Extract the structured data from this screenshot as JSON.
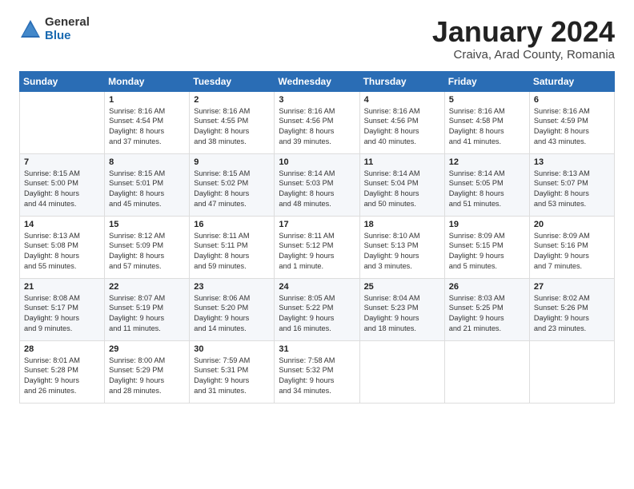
{
  "logo": {
    "general": "General",
    "blue": "Blue"
  },
  "title": "January 2024",
  "subtitle": "Craiva, Arad County, Romania",
  "headers": [
    "Sunday",
    "Monday",
    "Tuesday",
    "Wednesday",
    "Thursday",
    "Friday",
    "Saturday"
  ],
  "weeks": [
    [
      {
        "day": "",
        "info": ""
      },
      {
        "day": "1",
        "info": "Sunrise: 8:16 AM\nSunset: 4:54 PM\nDaylight: 8 hours\nand 37 minutes."
      },
      {
        "day": "2",
        "info": "Sunrise: 8:16 AM\nSunset: 4:55 PM\nDaylight: 8 hours\nand 38 minutes."
      },
      {
        "day": "3",
        "info": "Sunrise: 8:16 AM\nSunset: 4:56 PM\nDaylight: 8 hours\nand 39 minutes."
      },
      {
        "day": "4",
        "info": "Sunrise: 8:16 AM\nSunset: 4:56 PM\nDaylight: 8 hours\nand 40 minutes."
      },
      {
        "day": "5",
        "info": "Sunrise: 8:16 AM\nSunset: 4:58 PM\nDaylight: 8 hours\nand 41 minutes."
      },
      {
        "day": "6",
        "info": "Sunrise: 8:16 AM\nSunset: 4:59 PM\nDaylight: 8 hours\nand 43 minutes."
      }
    ],
    [
      {
        "day": "7",
        "info": "Sunrise: 8:15 AM\nSunset: 5:00 PM\nDaylight: 8 hours\nand 44 minutes."
      },
      {
        "day": "8",
        "info": "Sunrise: 8:15 AM\nSunset: 5:01 PM\nDaylight: 8 hours\nand 45 minutes."
      },
      {
        "day": "9",
        "info": "Sunrise: 8:15 AM\nSunset: 5:02 PM\nDaylight: 8 hours\nand 47 minutes."
      },
      {
        "day": "10",
        "info": "Sunrise: 8:14 AM\nSunset: 5:03 PM\nDaylight: 8 hours\nand 48 minutes."
      },
      {
        "day": "11",
        "info": "Sunrise: 8:14 AM\nSunset: 5:04 PM\nDaylight: 8 hours\nand 50 minutes."
      },
      {
        "day": "12",
        "info": "Sunrise: 8:14 AM\nSunset: 5:05 PM\nDaylight: 8 hours\nand 51 minutes."
      },
      {
        "day": "13",
        "info": "Sunrise: 8:13 AM\nSunset: 5:07 PM\nDaylight: 8 hours\nand 53 minutes."
      }
    ],
    [
      {
        "day": "14",
        "info": "Sunrise: 8:13 AM\nSunset: 5:08 PM\nDaylight: 8 hours\nand 55 minutes."
      },
      {
        "day": "15",
        "info": "Sunrise: 8:12 AM\nSunset: 5:09 PM\nDaylight: 8 hours\nand 57 minutes."
      },
      {
        "day": "16",
        "info": "Sunrise: 8:11 AM\nSunset: 5:11 PM\nDaylight: 8 hours\nand 59 minutes."
      },
      {
        "day": "17",
        "info": "Sunrise: 8:11 AM\nSunset: 5:12 PM\nDaylight: 9 hours\nand 1 minute."
      },
      {
        "day": "18",
        "info": "Sunrise: 8:10 AM\nSunset: 5:13 PM\nDaylight: 9 hours\nand 3 minutes."
      },
      {
        "day": "19",
        "info": "Sunrise: 8:09 AM\nSunset: 5:15 PM\nDaylight: 9 hours\nand 5 minutes."
      },
      {
        "day": "20",
        "info": "Sunrise: 8:09 AM\nSunset: 5:16 PM\nDaylight: 9 hours\nand 7 minutes."
      }
    ],
    [
      {
        "day": "21",
        "info": "Sunrise: 8:08 AM\nSunset: 5:17 PM\nDaylight: 9 hours\nand 9 minutes."
      },
      {
        "day": "22",
        "info": "Sunrise: 8:07 AM\nSunset: 5:19 PM\nDaylight: 9 hours\nand 11 minutes."
      },
      {
        "day": "23",
        "info": "Sunrise: 8:06 AM\nSunset: 5:20 PM\nDaylight: 9 hours\nand 14 minutes."
      },
      {
        "day": "24",
        "info": "Sunrise: 8:05 AM\nSunset: 5:22 PM\nDaylight: 9 hours\nand 16 minutes."
      },
      {
        "day": "25",
        "info": "Sunrise: 8:04 AM\nSunset: 5:23 PM\nDaylight: 9 hours\nand 18 minutes."
      },
      {
        "day": "26",
        "info": "Sunrise: 8:03 AM\nSunset: 5:25 PM\nDaylight: 9 hours\nand 21 minutes."
      },
      {
        "day": "27",
        "info": "Sunrise: 8:02 AM\nSunset: 5:26 PM\nDaylight: 9 hours\nand 23 minutes."
      }
    ],
    [
      {
        "day": "28",
        "info": "Sunrise: 8:01 AM\nSunset: 5:28 PM\nDaylight: 9 hours\nand 26 minutes."
      },
      {
        "day": "29",
        "info": "Sunrise: 8:00 AM\nSunset: 5:29 PM\nDaylight: 9 hours\nand 28 minutes."
      },
      {
        "day": "30",
        "info": "Sunrise: 7:59 AM\nSunset: 5:31 PM\nDaylight: 9 hours\nand 31 minutes."
      },
      {
        "day": "31",
        "info": "Sunrise: 7:58 AM\nSunset: 5:32 PM\nDaylight: 9 hours\nand 34 minutes."
      },
      {
        "day": "",
        "info": ""
      },
      {
        "day": "",
        "info": ""
      },
      {
        "day": "",
        "info": ""
      }
    ]
  ]
}
